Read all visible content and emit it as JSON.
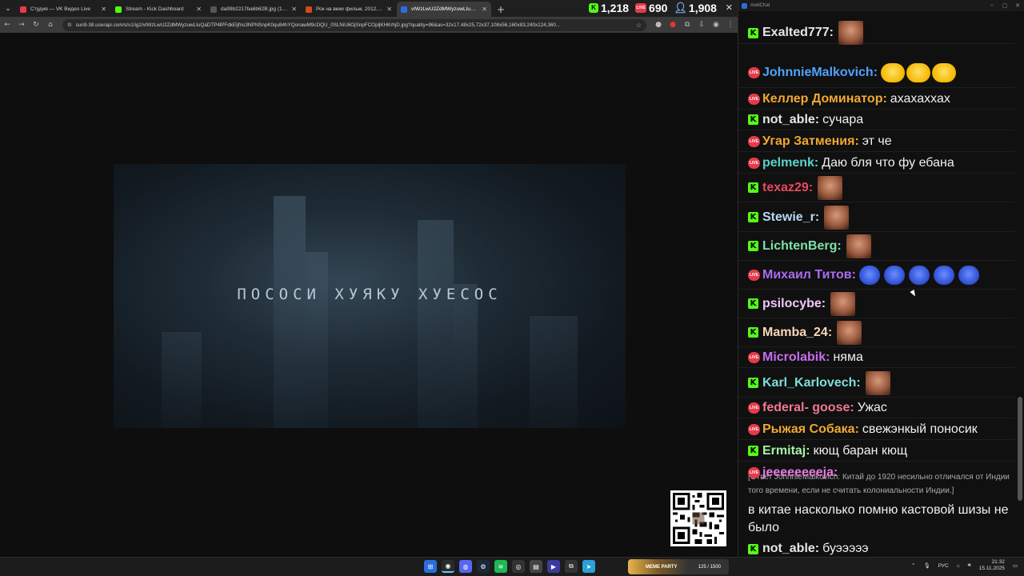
{
  "tabs": [
    {
      "label": "Студия — VK Видео Live",
      "color": "#e63a4a"
    },
    {
      "label": "Stream - Kick Dashboard",
      "color": "#53fc18"
    },
    {
      "label": "da99b2217ba6b62B.jpg (1358×...",
      "color": "#555555"
    },
    {
      "label": "Рок на веки фильм, 2012, дата...",
      "color": "#d04a1a"
    },
    {
      "label": "vIWzLwU2ZdMWyzuwLIuQaDT...",
      "color": "#2b6de0"
    }
  ],
  "stats": {
    "kick": "1,218",
    "vk": "690",
    "viewers": "1,908"
  },
  "url": "sun9-38.userapi.com/s/v1/ig2/vIWzLwU2ZdMWyzuwLIuQaDTP4lPFdkEljfns3NPNSnpK0qu84hYQonawM9cDQU_0SLNiU6OjSnpFCOpljKHKrhjD.jpg?quality=96&as=32x17,48x25,72x37,108x56,160x83,240x124,360...",
  "image_caption": "ПОСОСИ ХУЯКУ ХУЕСОС",
  "chat_title": "AxelChat",
  "messages": [
    {
      "platform": "kick",
      "user": "Exalted777:",
      "color": "#e6e6e6",
      "text": "",
      "emotes": "face1"
    },
    {
      "platform": "vk",
      "user": "JohnnieMalkovich:",
      "color": "#4fa3ff",
      "text": "",
      "emotes": "laugh3"
    },
    {
      "platform": "vk",
      "user": "Келлер Доминатор:",
      "color": "#f0a832",
      "text": "ахахаххах",
      "emotes": ""
    },
    {
      "platform": "kick",
      "user": "not_able:",
      "color": "#e6e6e6",
      "text": "сучара",
      "emotes": ""
    },
    {
      "platform": "vk",
      "user": "Угар Затмения:",
      "color": "#f0a832",
      "text": "эт че",
      "emotes": ""
    },
    {
      "platform": "vk",
      "user": "pelmenk:",
      "color": "#5ad2c8",
      "text": "Даю бля что фу ебана",
      "emotes": ""
    },
    {
      "platform": "kick",
      "user": "texaz29:",
      "color": "#e84a5f",
      "text": "",
      "emotes": "face1"
    },
    {
      "platform": "kick",
      "user": "Stewie_r:",
      "color": "#b8d8f8",
      "text": "",
      "emotes": "face1"
    },
    {
      "platform": "kick",
      "user": "LichtenBerg:",
      "color": "#7ee0a8",
      "text": "",
      "emotes": "face1"
    },
    {
      "platform": "vk",
      "user": "Михаил Титов:",
      "color": "#a86cf0",
      "text": "",
      "emotes": "cry5"
    },
    {
      "platform": "kick",
      "user": "psilocybe:",
      "color": "#f0c8f8",
      "text": "",
      "emotes": "face1"
    },
    {
      "platform": "kick",
      "user": "Mamba_24:",
      "color": "#f8d8b8",
      "text": "",
      "emotes": "face1"
    },
    {
      "platform": "vk",
      "user": "Microlabik:",
      "color": "#c86cf0",
      "text": "няма",
      "emotes": ""
    },
    {
      "platform": "kick",
      "user": "Karl_Karlovech:",
      "color": "#7ee0d8",
      "text": "",
      "emotes": "face1"
    },
    {
      "platform": "vk",
      "user": "federal- goose:",
      "color": "#f07890",
      "text": "Ужас",
      "emotes": ""
    },
    {
      "platform": "vk",
      "user": "Рыжая Собака:",
      "color": "#f0a832",
      "text": "свежэнкый поносик",
      "emotes": ""
    },
    {
      "platform": "kick",
      "user": "Ermitaj:",
      "color": "#a8f0a8",
      "text": "кющ баран кющ",
      "emotes": ""
    },
    {
      "platform": "vk",
      "user": "jeeeeeeeeja:",
      "color": "#e87ae0",
      "text": "",
      "emotes": ""
    }
  ],
  "reply_text": "[Ответ JohnnieMalkovich: Китай до 1920 несильно отличался от Индии того времени, если не считать колониальности Индии.]",
  "reply_body": "в китае насколько помню кастовой шизы не было",
  "last_message": {
    "platform": "kick",
    "user": "not_able:",
    "color": "#e6e6e6",
    "text": "буэээээ"
  },
  "badges": {
    "kick": "K",
    "vk": "LIVE"
  },
  "widget": {
    "title": "MEME PARTY",
    "value": "125 / 1500"
  },
  "tray": {
    "lang": "РУС",
    "time": "21:32",
    "date": "15.11.2025"
  }
}
